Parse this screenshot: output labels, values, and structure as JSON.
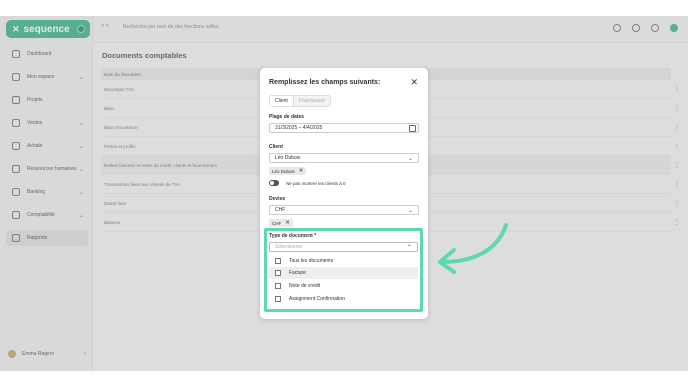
{
  "brand": {
    "name": "sequence",
    "accent": "#3fb58c",
    "highlight": "#5ed8b3"
  },
  "sidebar": {
    "items": [
      {
        "label": "Dashboard",
        "icon": "home-icon",
        "chevron": false
      },
      {
        "label": "Mon espace",
        "icon": "user-icon",
        "chevron": true
      },
      {
        "label": "Projets",
        "icon": "folder-icon",
        "chevron": false
      },
      {
        "label": "Ventes",
        "icon": "tag-icon",
        "chevron": true
      },
      {
        "label": "Achats",
        "icon": "cart-icon",
        "chevron": true
      },
      {
        "label": "Ressources humaines",
        "icon": "people-icon",
        "chevron": true
      },
      {
        "label": "Banking",
        "icon": "bank-icon",
        "chevron": true
      },
      {
        "label": "Comptabilité",
        "icon": "calculator-icon",
        "chevron": true
      },
      {
        "label": "Rapports",
        "icon": "chart-icon",
        "chevron": false,
        "active": true
      }
    ],
    "user": "Emma Rogers"
  },
  "topbar": {
    "search_placeholder": "Recherche par nom de des fonctions salles"
  },
  "main": {
    "title": "Documents comptables",
    "table_header": "Nom du document",
    "rows": [
      "Décompte TVA",
      "Bilan",
      "Bilan d'ouverture",
      "Pertes et profits",
      "Relevé factures et notes de crédit, clients et fournisseurs",
      "Transactions liées aux relevés de TVA",
      "Grand livre",
      "Balance"
    ]
  },
  "modal": {
    "title": "Remplissez les champs suivants:",
    "tabs": [
      "Client",
      "Fournisseur"
    ],
    "date_label": "Plage de dates",
    "date_value": "31/3/2025 – 4/4/2025",
    "client_label": "Client",
    "client_value": "Léo Dubois",
    "client_chip": "Léo Dubois",
    "toggle_label": "Ne pas montrer les clients à 0",
    "currency_label": "Devise",
    "currency_value": "CHF",
    "currency_chip": "CHF",
    "doctype_label": "Type de document *",
    "doctype_placeholder": "Sélectionner",
    "options": [
      "Tous les documents",
      "Facture",
      "Note de crédit",
      "Assignment Confirmation"
    ]
  }
}
